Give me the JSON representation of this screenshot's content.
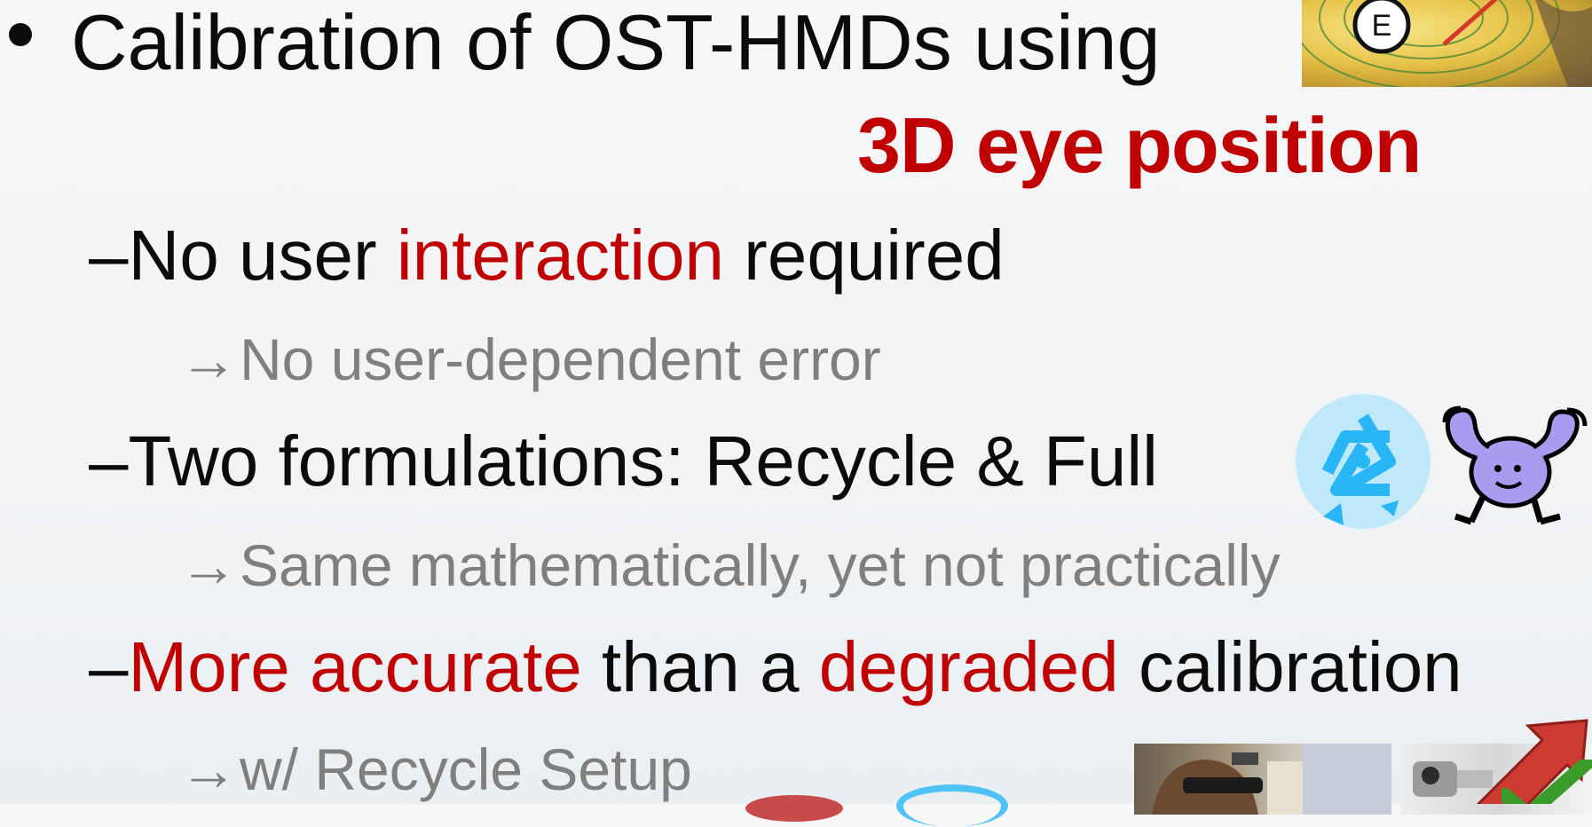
{
  "slide": {
    "bullet1": {
      "text": "Calibration of OST-HMDs using",
      "continuation": "3D eye position"
    },
    "sub1": {
      "dash": "–",
      "pre": "No user ",
      "highlight": "interaction",
      "post": " required"
    },
    "sub1_note": {
      "arrow": "→",
      "text": "No user-dependent error"
    },
    "sub2": {
      "dash": "–",
      "text": "Two formulations: Recycle & Full"
    },
    "sub2_note": {
      "arrow": "→",
      "text": "Same mathematically, yet not practically"
    },
    "sub3": {
      "dash": "–",
      "highlight1": "More accurate",
      "mid": " than a ",
      "highlight2": "degraded",
      "post": " calibration"
    },
    "sub3_note": {
      "arrow": "→",
      "text": "w/ Recycle Setup"
    },
    "eye_label": "E"
  },
  "colors": {
    "accent_red": "#c00000",
    "body_black": "#0b0b0b",
    "note_gray": "#7f7f7f",
    "recycle_blue": "#4fc3f7",
    "strong_purple": "#a99cf0"
  },
  "icons": [
    "eye-photo",
    "recycle-icon",
    "strong-man-icon",
    "hmd-user-photo",
    "camera-photo",
    "upward-arrow-icon",
    "check-mark-icon"
  ]
}
